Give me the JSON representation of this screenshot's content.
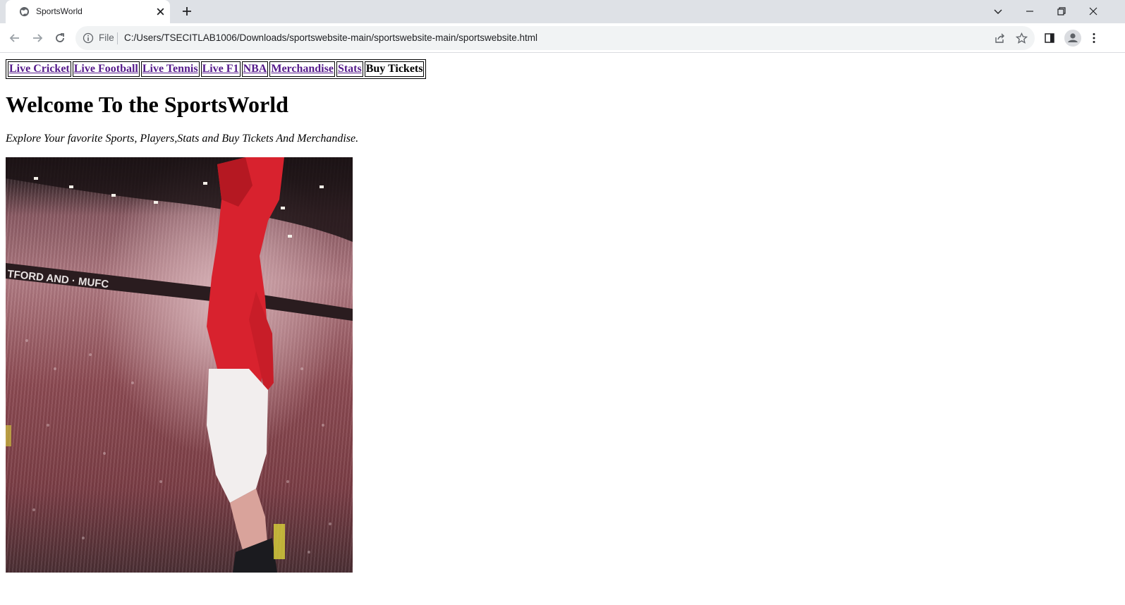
{
  "browser": {
    "tab_title": "SportsWorld",
    "omnibox_scheme_label": "File",
    "url": "C:/Users/TSECITLAB1006/Downloads/sportswebsite-main/sportswebsite-main/sportswebsite.html",
    "icons": [
      "globe-icon",
      "close-icon",
      "plus-icon",
      "chevron-down-icon",
      "minimize-icon",
      "restore-icon",
      "window-close-icon",
      "back-arrow-icon",
      "forward-arrow-icon",
      "reload-icon",
      "info-icon",
      "share-icon",
      "star-icon",
      "side-panel-icon",
      "profile-icon",
      "kebab-menu-icon"
    ]
  },
  "page": {
    "nav": {
      "items": [
        {
          "label": "Live Cricket"
        },
        {
          "label": "Live Football"
        },
        {
          "label": "Live Tennis"
        },
        {
          "label": "Live F1"
        },
        {
          "label": "NBA"
        },
        {
          "label": "Merchandise"
        },
        {
          "label": "Stats"
        },
        {
          "label": "Buy Tickets"
        }
      ],
      "link_color": "#551a8b"
    },
    "heading": "Welcome To the SportsWorld",
    "tagline": "Explore Your favorite Sports, Players,Stats and Buy Tickets And Merchandise.",
    "hero_banner_text": "TFORD AND · MUFC"
  }
}
